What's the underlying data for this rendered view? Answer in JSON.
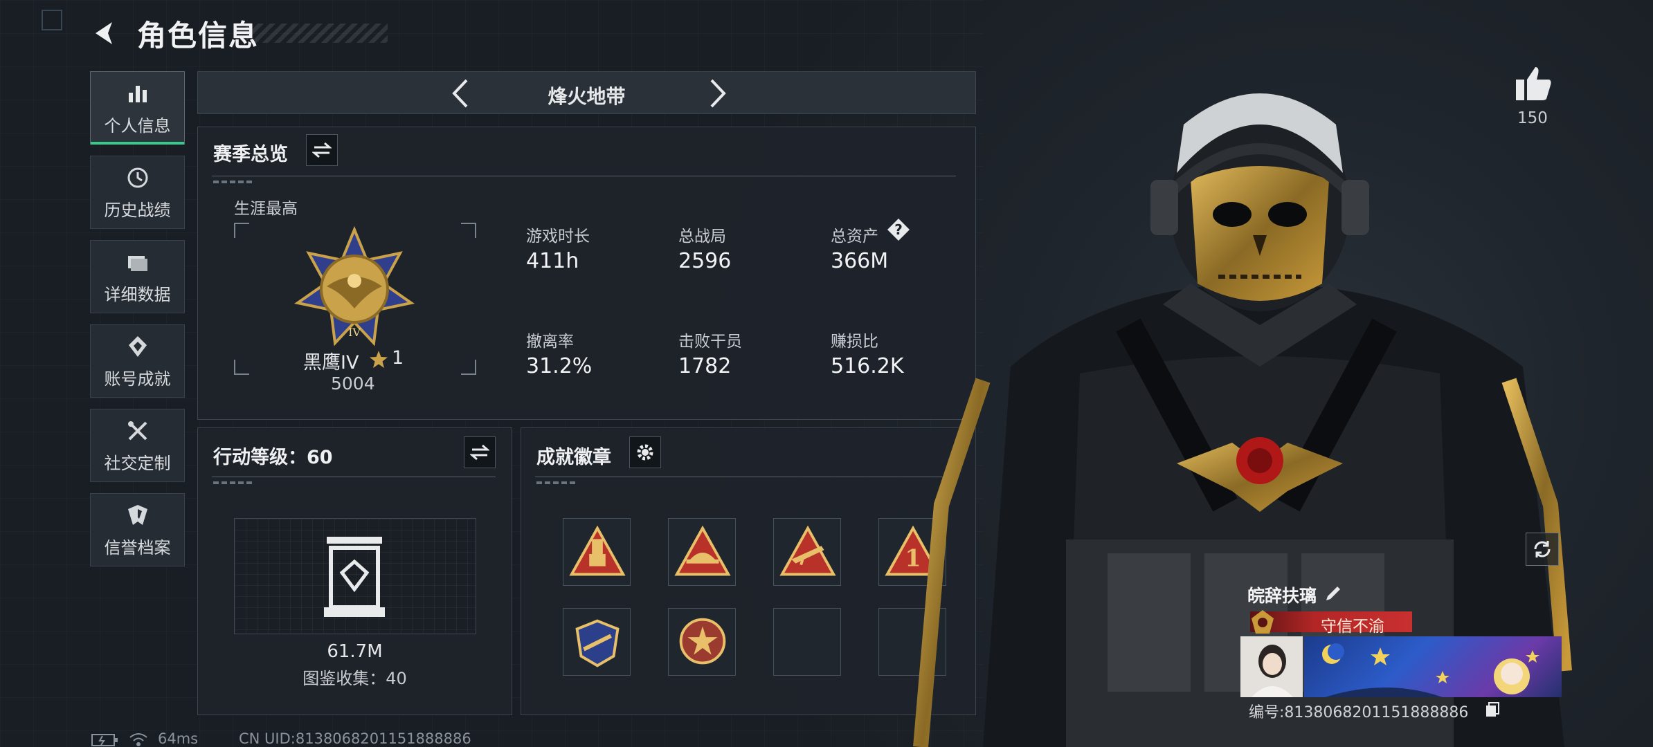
{
  "header": {
    "title": "角色信息"
  },
  "sidebar": {
    "items": [
      {
        "label": "个人信息",
        "icon": "bar-chart-icon",
        "active": true
      },
      {
        "label": "历史战绩",
        "icon": "history-icon",
        "active": false
      },
      {
        "label": "详细数据",
        "icon": "folder-icon",
        "active": false
      },
      {
        "label": "账号成就",
        "icon": "achievement-icon",
        "active": false
      },
      {
        "label": "社交定制",
        "icon": "tools-icon",
        "active": false
      },
      {
        "label": "信誉档案",
        "icon": "shield-icon",
        "active": false
      }
    ]
  },
  "mode": {
    "label": "烽火地带"
  },
  "season": {
    "title": "赛季总览",
    "career_label": "生涯最高",
    "rank_name": "黑鹰IV",
    "rank_stars": "1",
    "rank_score": "5004",
    "stats": [
      {
        "label": "游戏时长",
        "value": "411h"
      },
      {
        "label": "总战局",
        "value": "2596"
      },
      {
        "label": "总资产",
        "value": "366M"
      },
      {
        "label": "撤离率",
        "value": "31.2%"
      },
      {
        "label": "击败干员",
        "value": "1782"
      },
      {
        "label": "赚损比",
        "value": "516.2K"
      }
    ],
    "help_label": "?"
  },
  "action_level": {
    "title": "行动等级：60",
    "value": "61.7M",
    "collection": "图鉴收集：40"
  },
  "badges": {
    "title": "成就徽章",
    "slots": [
      {
        "filled": true,
        "color": "#b8322a",
        "symbol": "usb"
      },
      {
        "filled": true,
        "color": "#b8322a",
        "symbol": "hat"
      },
      {
        "filled": true,
        "color": "#b8322a",
        "symbol": "rifle"
      },
      {
        "filled": true,
        "color": "#b8322a",
        "symbol": "one"
      },
      {
        "filled": true,
        "color": "#2b3f8a",
        "symbol": "shield"
      },
      {
        "filled": true,
        "color": "#9b3a2e",
        "symbol": "star"
      },
      {
        "filled": false
      },
      {
        "filled": false
      }
    ]
  },
  "likes": {
    "count": "150"
  },
  "profile": {
    "name": "皖辞扶璃",
    "title_tag": "守信不渝",
    "id_line": "编号:8138068201151888886"
  },
  "status": {
    "ping": "64ms",
    "uid": "CN UID:8138068201151888886"
  },
  "colors": {
    "accent_green": "#39c98a",
    "rank_gold": "#c9a24a",
    "title_red": "#b32626"
  }
}
